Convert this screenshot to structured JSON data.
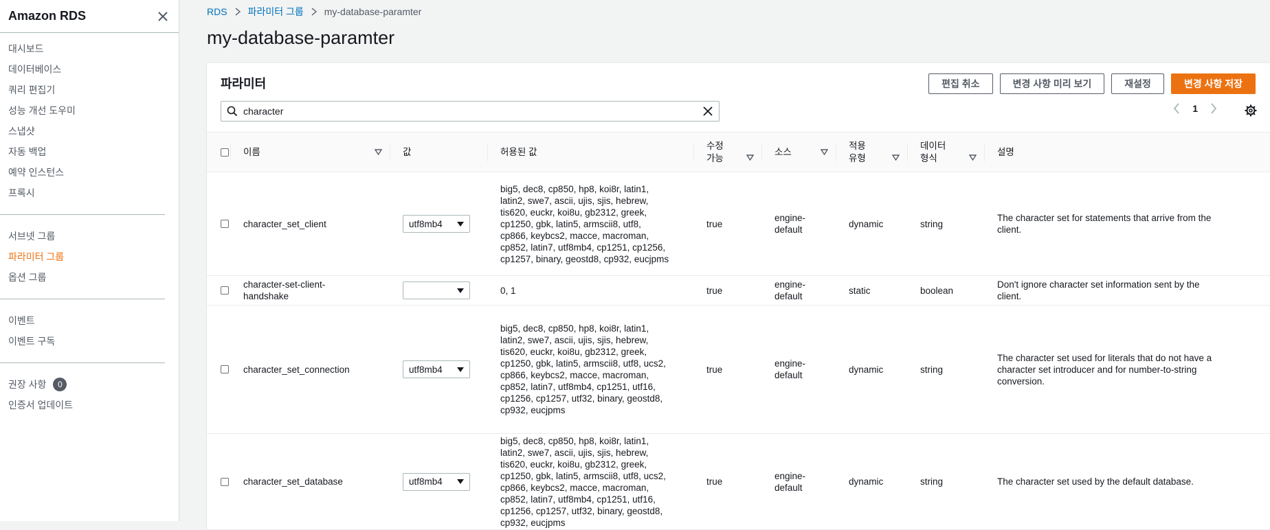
{
  "sidebar": {
    "title": "Amazon RDS",
    "groups": [
      [
        "대시보드",
        "데이터베이스",
        "쿼리 편집기",
        "성능 개선 도우미",
        "스냅샷",
        "자동 백업",
        "예약 인스턴스",
        "프록시"
      ],
      [
        "서브넷 그룹",
        "파라미터 그룹",
        "옵션 그룹"
      ],
      [
        "이벤트",
        "이벤트 구독"
      ]
    ],
    "recommendations_label": "권장 사항",
    "recommendations_count": "0",
    "cert_update_label": "인증서 업데이트"
  },
  "breadcrumb": {
    "root": "RDS",
    "parent": "파라미터 그룹",
    "current": "my-database-paramter"
  },
  "page_title": "my-database-paramter",
  "panel": {
    "title": "파라미터",
    "buttons": {
      "cancel": "편집 취소",
      "preview": "변경 사항 미리 보기",
      "reset": "재설정",
      "save": "변경 사항 저장"
    },
    "search_value": "character",
    "page_number": "1"
  },
  "table": {
    "headers": {
      "name": "이름",
      "value": "값",
      "allowed": "허용된 값",
      "modifiable_1": "수정",
      "modifiable_2": "가능",
      "source": "소스",
      "apply_1": "적용",
      "apply_2": "유형",
      "dtype_1": "데이터",
      "dtype_2": "형식",
      "desc": "설명"
    },
    "rows": [
      {
        "name": "character_set_client",
        "value": "utf8mb4",
        "allowed": [
          "big5, dec8, cp850, hp8, koi8r, latin1,",
          "latin2, swe7, ascii, ujis, sjis, hebrew,",
          "tis620, euckr, koi8u, gb2312, greek,",
          "cp1250, gbk, latin5, armscii8, utf8,",
          "cp866, keybcs2, macce, macroman,",
          "cp852, latin7, utf8mb4, cp1251, cp1256,",
          "cp1257, binary, geostd8, cp932, eucjpms"
        ],
        "modifiable": "true",
        "source": [
          "engine-",
          "default"
        ],
        "apply_type": "dynamic",
        "data_type": "string",
        "description": [
          "The character set for statements that arrive from the",
          "client."
        ]
      },
      {
        "name": [
          "character-set-client-",
          "handshake"
        ],
        "value": "",
        "allowed": [
          "0, 1"
        ],
        "modifiable": "true",
        "source": [
          "engine-",
          "default"
        ],
        "apply_type": "static",
        "data_type": "boolean",
        "description": [
          "Don't ignore character set information sent by the",
          "client."
        ]
      },
      {
        "name": "character_set_connection",
        "value": "utf8mb4",
        "allowed": [
          "big5, dec8, cp850, hp8, koi8r, latin1,",
          "latin2, swe7, ascii, ujis, sjis, hebrew,",
          "tis620, euckr, koi8u, gb2312, greek,",
          "cp1250, gbk, latin5, armscii8, utf8, ucs2,",
          "cp866, keybcs2, macce, macroman,",
          "cp852, latin7, utf8mb4, cp1251, utf16,",
          "cp1256, cp1257, utf32, binary, geostd8,",
          "cp932, eucjpms"
        ],
        "modifiable": "true",
        "source": [
          "engine-",
          "default"
        ],
        "apply_type": "dynamic",
        "data_type": "string",
        "description": [
          "The character set used for literals that do not have a",
          "character set introducer and for number-to-string",
          "conversion."
        ]
      },
      {
        "name": "character_set_database",
        "value": "utf8mb4",
        "allowed": [
          "big5, dec8, cp850, hp8, koi8r, latin1,",
          "latin2, swe7, ascii, ujis, sjis, hebrew,",
          "tis620, euckr, koi8u, gb2312, greek,",
          "cp1250, gbk, latin5, armscii8, utf8, ucs2,",
          "cp866, keybcs2, macce, macroman,",
          "cp852, latin7, utf8mb4, cp1251, utf16,",
          "cp1256, cp1257, utf32, binary, geostd8,",
          "cp932, eucjpms"
        ],
        "modifiable": "true",
        "source": [
          "engine-",
          "default"
        ],
        "apply_type": "dynamic",
        "data_type": "string",
        "description": [
          "The character set used by the default database."
        ]
      }
    ]
  },
  "colors": {
    "accent": "#ec7211",
    "link": "#0073bb",
    "text": "#16191f",
    "muted": "#545b64"
  }
}
